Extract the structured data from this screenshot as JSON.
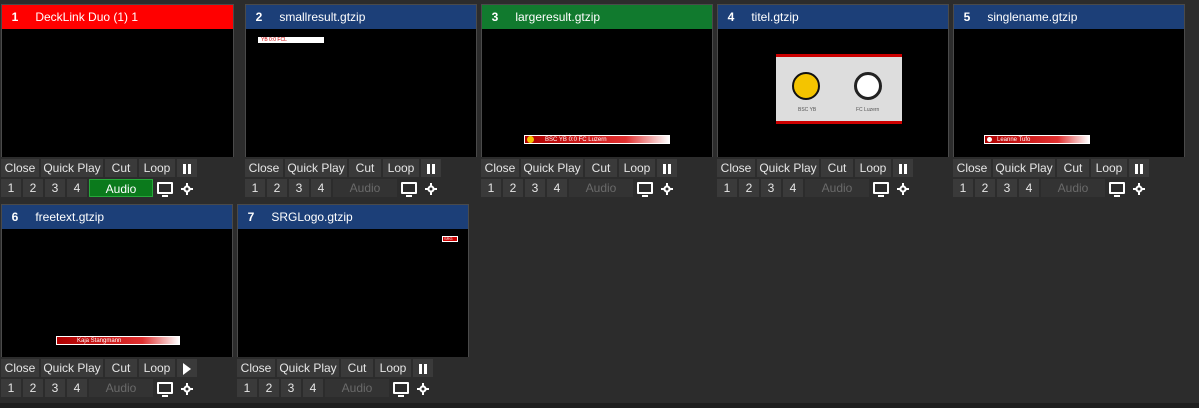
{
  "buttons": {
    "close": "Close",
    "quick_play": "Quick Play",
    "cut": "Cut",
    "loop": "Loop",
    "audio": "Audio",
    "ch1": "1",
    "ch2": "2",
    "ch3": "3",
    "ch4": "4"
  },
  "inputs": [
    {
      "number": "1",
      "title": "DeckLink Duo (1) 1",
      "header_color": "#ff0000"
    },
    {
      "number": "2",
      "title": "smallresult.gtzip",
      "header_color": "#1c3f78"
    },
    {
      "number": "3",
      "title": "largeresult.gtzip",
      "header_color": "#117a2e"
    },
    {
      "number": "4",
      "title": "titel.gtzip",
      "header_color": "#1c3f78"
    },
    {
      "number": "5",
      "title": "singlename.gtzip",
      "header_color": "#1c3f78"
    },
    {
      "number": "6",
      "title": "freetext.gtzip",
      "header_color": "#1c3f78"
    },
    {
      "number": "7",
      "title": "SRGLogo.gtzip",
      "header_color": "#1c3f78"
    }
  ],
  "previews": {
    "p2_text": "YB  0:0  FCL",
    "p3_text": "BSC YB    0:0    FC Luzern",
    "p4_left": "BSC YB",
    "p4_right": "FC Luzern",
    "p5_text": "Leanne Tufo",
    "p6_text": "Kaja Stangmann",
    "p7_text": "SRG"
  },
  "colors": {
    "audio_on": "#0b7a1c",
    "live_red": "#ff0000",
    "preview_green": "#117a2e",
    "input_blue": "#1c3f78"
  }
}
